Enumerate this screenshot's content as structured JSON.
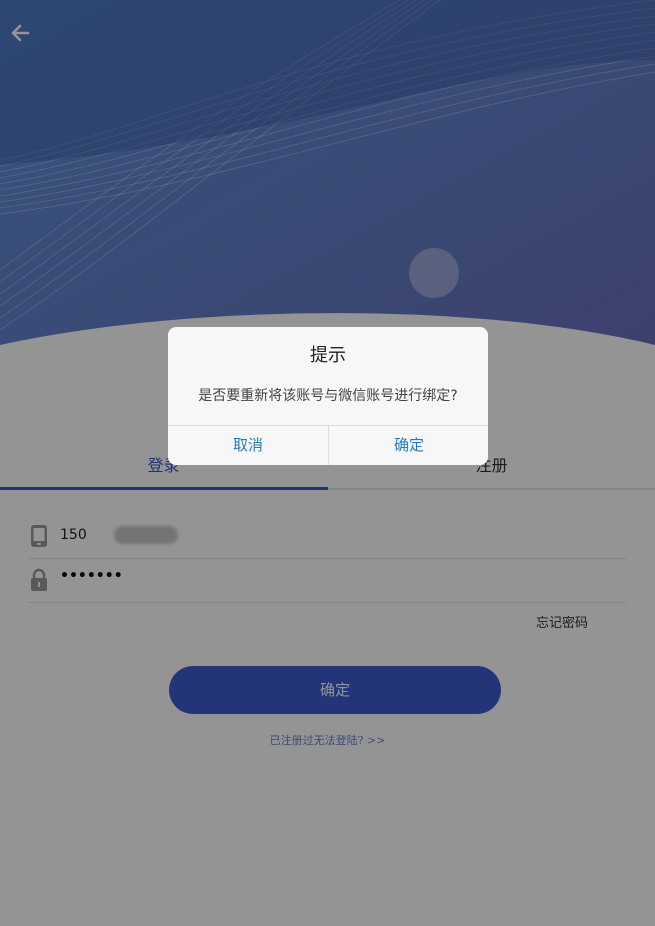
{
  "colors": {
    "primary": "#3d5ccf",
    "header_gradient_start": "#5a8fd8",
    "header_gradient_end": "#6670c2",
    "dialog_button": "#1e7cbe"
  },
  "header": {
    "back_icon": "arrow-left-icon"
  },
  "tabs": [
    {
      "label": "登录",
      "active": true
    },
    {
      "label": "注册",
      "active": false
    }
  ],
  "form": {
    "phone_icon": "phone-icon",
    "phone_value": "150",
    "password_icon": "lock-icon",
    "password_value": "•••••••",
    "forgot_label": "忘记密码",
    "submit_label": "确定",
    "registered_hint": "已注册过无法登陆? >>"
  },
  "dialog": {
    "title": "提示",
    "message": "是否要重新将该账号与微信账号进行绑定?",
    "cancel_label": "取消",
    "confirm_label": "确定"
  }
}
